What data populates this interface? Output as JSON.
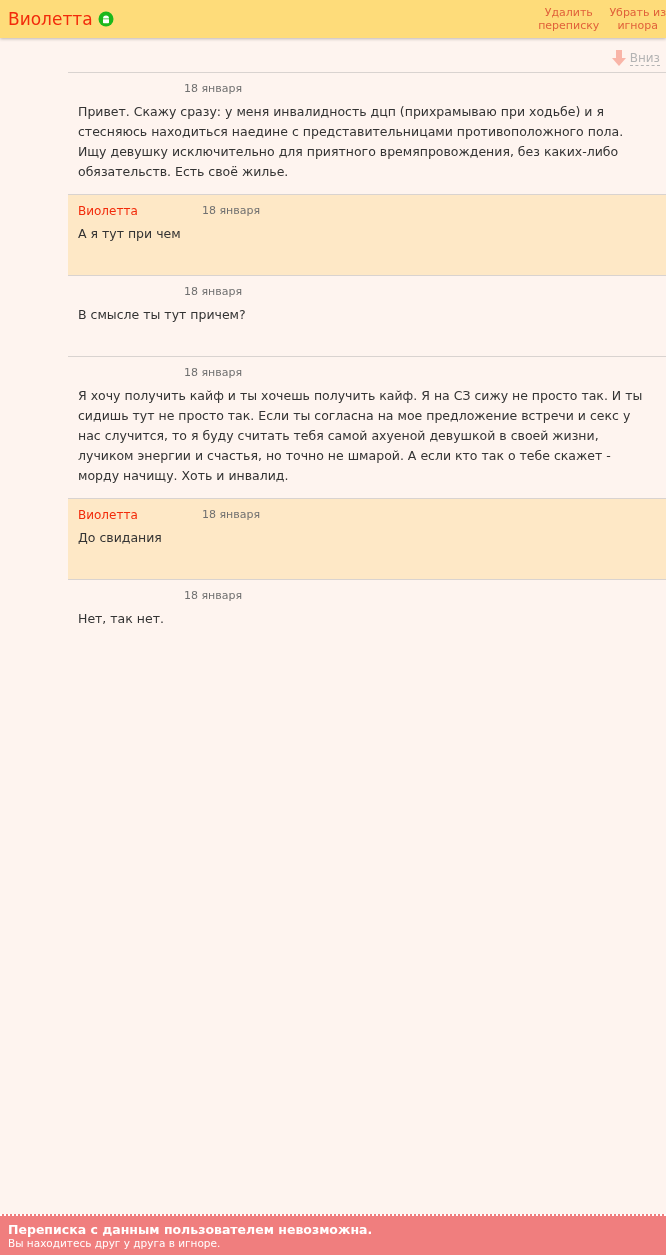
{
  "header": {
    "title": "Виолетта",
    "online": true,
    "actions": [
      {
        "lines": [
          "Удалить",
          "переписку"
        ]
      },
      {
        "lines": [
          "Убрать из",
          "игнора"
        ]
      }
    ]
  },
  "scroll_link": "Вниз",
  "messages": [
    {
      "mine": false,
      "date": "18 января",
      "text": "Привет. Скажу сразу: у меня инвалидность дцп (прихрамываю при ходьбе) и я стесняюсь находиться наедине с представительницами противоположного пола. Ищу девушку исключительно для приятного времяпровождения, без каких-либо обязательств. Есть своё жилье."
    },
    {
      "mine": true,
      "sender": "Виолетта",
      "date": "18 января",
      "text": "А я тут при чем"
    },
    {
      "mine": false,
      "date": "18 января",
      "text": "В смысле ты тут причем?"
    },
    {
      "mine": false,
      "date": "18 января",
      "text": "Я хочу получить кайф и ты хочешь получить кайф. Я на СЗ сижу не просто так. И ты сидишь тут не просто так. Если ты согласна на мое предложение встречи и секс у нас случится, то я буду считать тебя самой ахуеной девушкой в своей жизни, лучиком энергии и счастья, но точно не шмарой. А если кто так о тебе скажет - морду начищу. Хоть и инвалид."
    },
    {
      "mine": true,
      "sender": "Виолетта",
      "date": "18 января",
      "text": "До свидания"
    },
    {
      "mine": false,
      "date": "18 января",
      "text": "Нет, так нет."
    }
  ],
  "notice": {
    "title": "Переписка с данным пользователем невозможна.",
    "subtitle": "Вы находитесь друг у друга в игноре."
  }
}
